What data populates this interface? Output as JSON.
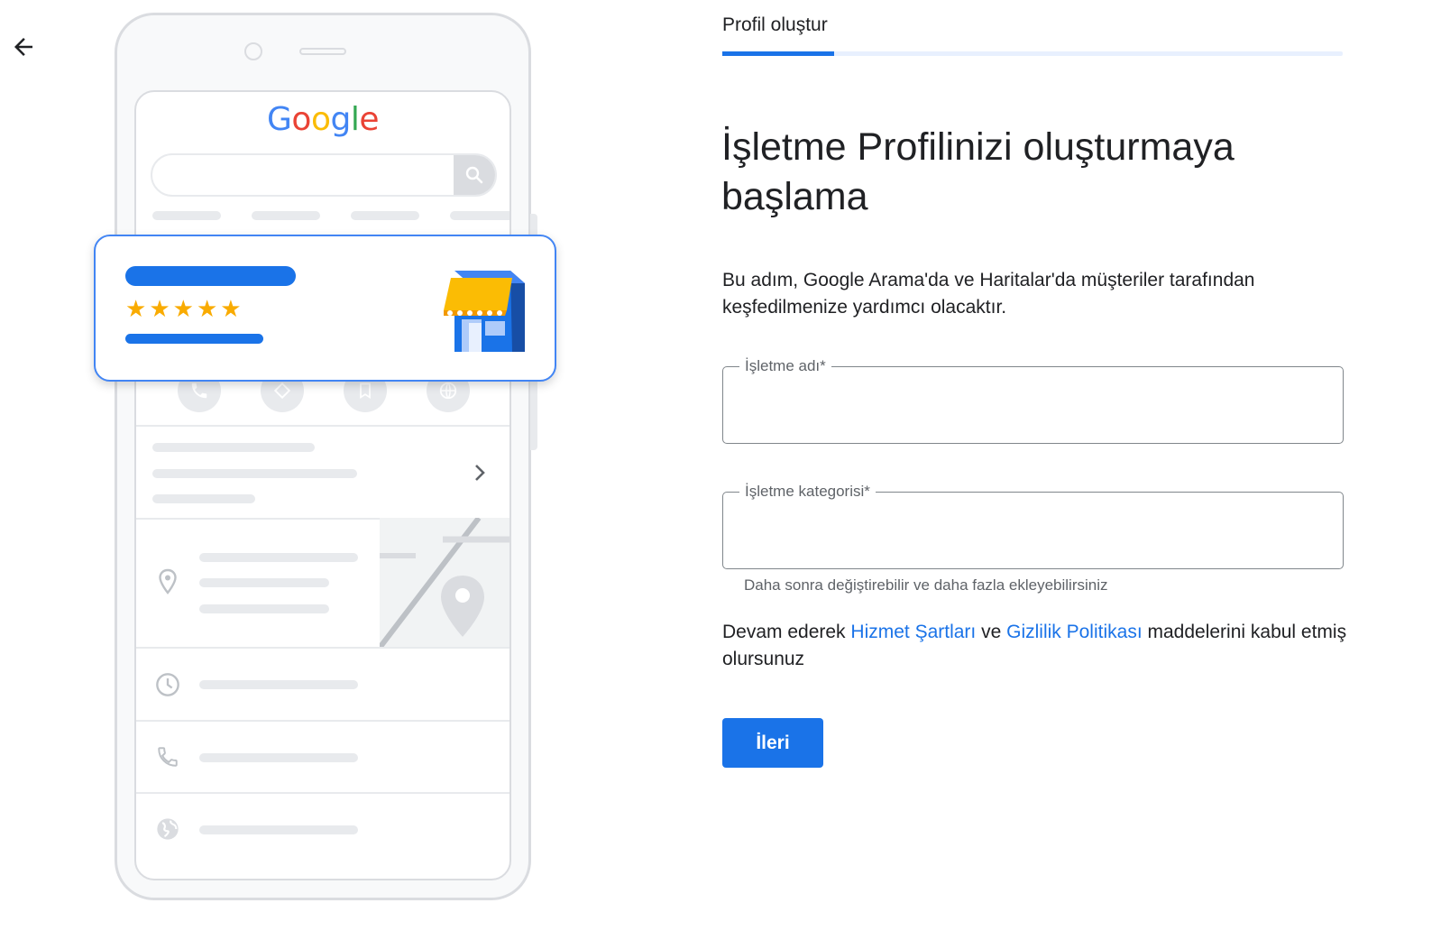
{
  "nav": {
    "back_icon": "arrow-back-icon"
  },
  "illustration": {
    "logo_letters": [
      "G",
      "o",
      "o",
      "g",
      "l",
      "e"
    ],
    "stars": [
      "★",
      "★",
      "★",
      "★",
      "★"
    ],
    "icons": [
      "search-icon",
      "phone-icon",
      "directions-icon",
      "bookmark-icon",
      "web-icon",
      "chevron-right-icon",
      "location-pin-icon",
      "clock-icon",
      "globe-icon",
      "store-icon"
    ]
  },
  "progress": {
    "label": "Profil oluştur",
    "fraction": 0.18
  },
  "title": "İşletme Profilinizi oluşturmaya başlama",
  "description": "Bu adım, Google Arama'da ve Haritalar'da müşteriler tarafından keşfedilmenize yardımcı olacaktır.",
  "fields": {
    "business_name": {
      "label": "İşletme adı*",
      "value": ""
    },
    "business_category": {
      "label": "İşletme kategorisi*",
      "value": "",
      "hint": "Daha sonra değiştirebilir ve daha fazla ekleyebilirsiniz"
    }
  },
  "terms": {
    "prefix": "Devam ederek ",
    "terms_link": "Hizmet Şartları",
    "middle": " ve ",
    "privacy_link": "Gizlilik Politikası",
    "suffix": " maddelerini kabul etmiş olursunuz"
  },
  "next_button": "İleri",
  "colors": {
    "accent": "#1a73e8",
    "star": "#f9ab00",
    "awning": "#fbbc04"
  }
}
